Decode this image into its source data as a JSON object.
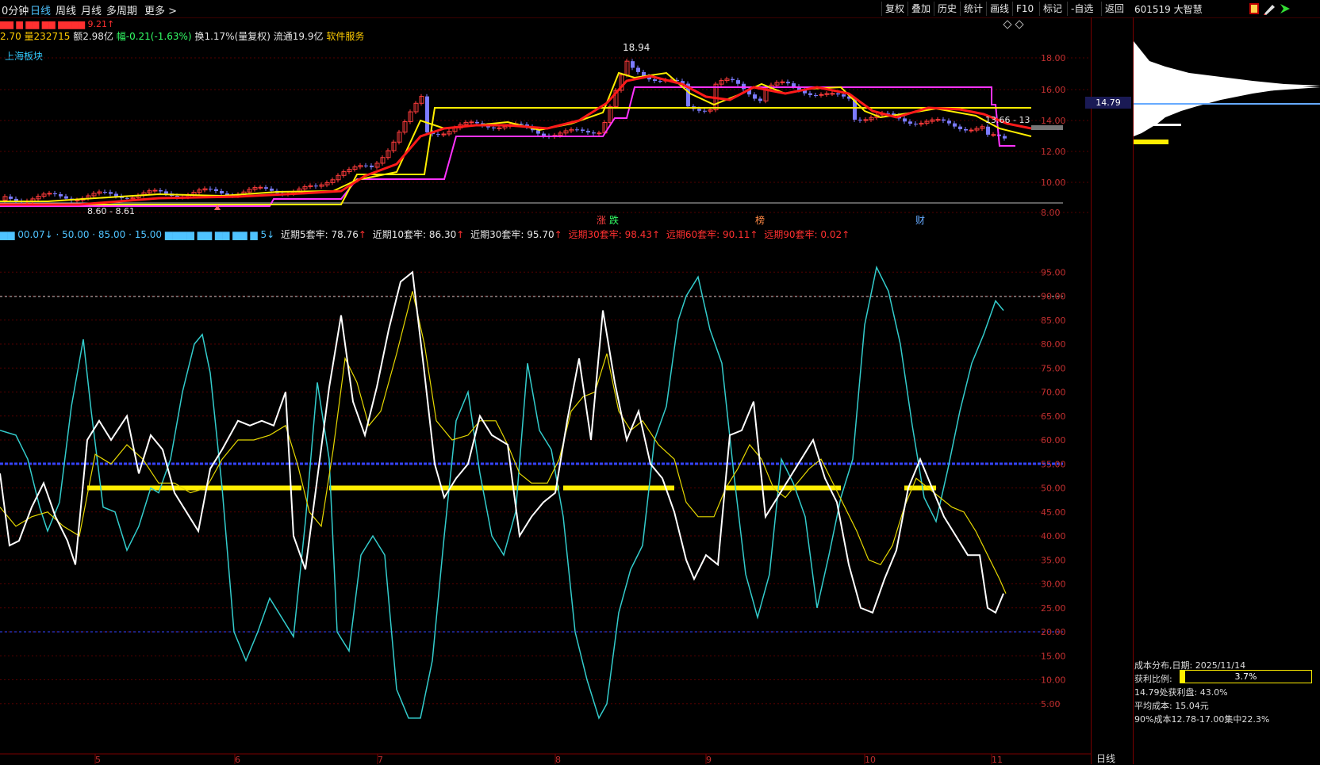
{
  "toolbar": {
    "period_tabs": [
      "0分钟",
      "日线",
      "周线",
      "月线",
      "多周期",
      "更多 >"
    ],
    "active_tab": "日线",
    "buttons": [
      "复权",
      "叠加",
      "历史",
      "统计",
      "画线",
      "F10",
      "标记",
      "-自选",
      "返回"
    ],
    "stock": "601519 大智慧"
  },
  "quote_line": {
    "prefix": "2.70",
    "volume": "量232715",
    "amount": "额2.98亿",
    "change": "幅-0.21(-1.63%)",
    "turnover": "换1.17%(量复权)",
    "float": "流通19.9亿",
    "sector": "软件服务"
  },
  "board_label": "上海板块",
  "price_chart": {
    "high_label": "18.94",
    "low_label": "8.60 - 8.61",
    "right_label": "13.66 - 13",
    "y_ticks": [
      "18.00",
      "16.00",
      "14.00",
      "12.00",
      "10.00",
      "8.00"
    ],
    "current_price": "14.79",
    "event_marks": [
      "涨",
      "跌",
      "榜",
      "财"
    ],
    "colors": {
      "ma_red": "#ff1a1a",
      "ma_yellow": "#ffee00",
      "band_magenta": "#ff33ff",
      "up_candle": "#ff3b3b",
      "down_candle": "#7b7bff"
    }
  },
  "osc_legend": [
    {
      "label": "近期5套牢: 78.76",
      "color": "#e6e6e6"
    },
    {
      "label": "近期10套牢: 86.30",
      "color": "#e6e6e6"
    },
    {
      "label": "近期30套牢: 95.70",
      "color": "#e6e6e6"
    },
    {
      "label": "远期30套牢: 98.43",
      "color": "#ff3030"
    },
    {
      "label": "远期60套牢: 90.11",
      "color": "#ff3030"
    },
    {
      "label": "远期90套牢: 0.02",
      "color": "#ff3030"
    }
  ],
  "osc_y_ticks": [
    "95.00",
    "90.00",
    "85.00",
    "80.00",
    "75.00",
    "70.00",
    "65.00",
    "60.00",
    "55.00",
    "50.00",
    "45.00",
    "40.00",
    "35.00",
    "30.00",
    "25.00",
    "20.00",
    "15.00",
    "10.00",
    "5.00"
  ],
  "x_month_ticks": [
    "5",
    "6",
    "7",
    "8",
    "9",
    "10",
    "11"
  ],
  "chip_panel": {
    "date_line": "成本分布,日期: 2025/11/14",
    "profit_label": "获利比例:",
    "profit_value": "3.7%",
    "profit_at_price": "14.79处获利盘: 43.0%",
    "avg_cost": "平均成本: 15.04元",
    "concentration": "90%成本12.78-17.00集中22.3%"
  },
  "bottom_tab": "日线"
}
